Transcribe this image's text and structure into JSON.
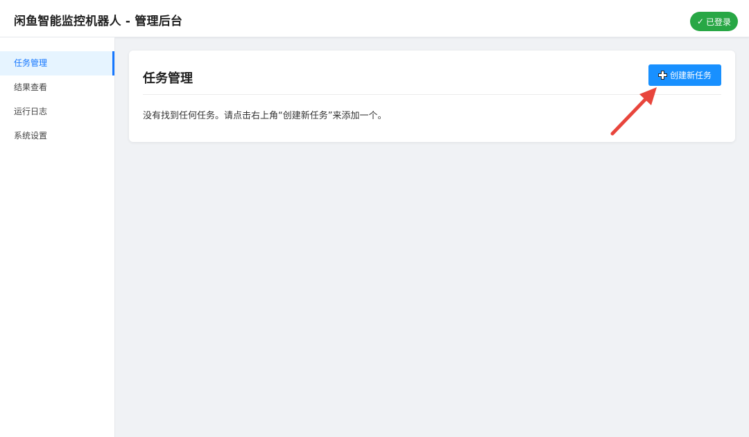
{
  "header": {
    "title": "闲鱼智能监控机器人 - 管理后台",
    "login_status": "已登录",
    "login_icon": "check-icon",
    "login_color": "#28a745"
  },
  "sidebar": {
    "items": [
      {
        "label": "任务管理",
        "active": true
      },
      {
        "label": "结果查看",
        "active": false
      },
      {
        "label": "运行日志",
        "active": false
      },
      {
        "label": "系统设置",
        "active": false
      }
    ]
  },
  "main": {
    "card_title": "任务管理",
    "create_button_label": "创建新任务",
    "create_button_icon": "plus-icon",
    "empty_message": "没有找到任何任务。请点击右上角“创建新任务”来添加一个。"
  },
  "colors": {
    "accent": "#1890ff",
    "annotation_arrow": "#e8453c"
  }
}
